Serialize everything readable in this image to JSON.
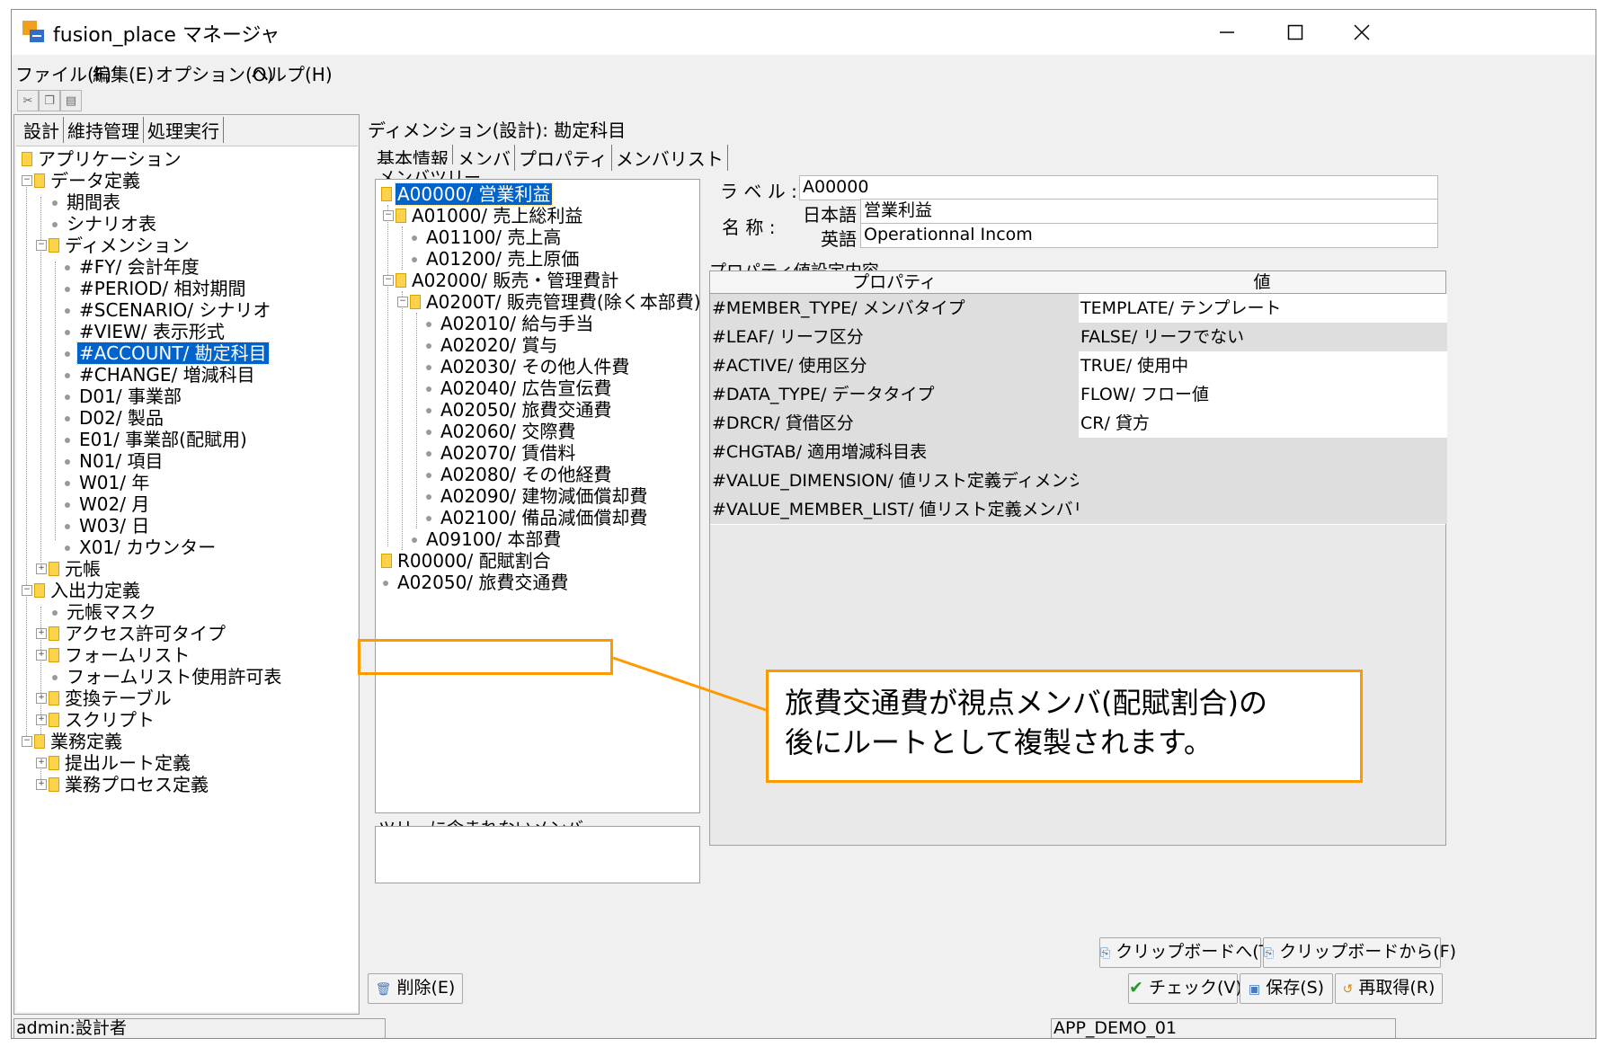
{
  "window": {
    "title": "fusion_place マネージャ",
    "minimize": "—",
    "maximize": "☐",
    "close": "✕"
  },
  "menu": [
    "ファイル(F)",
    "編集(E)",
    "オプション(O)",
    "ヘルプ(H)"
  ],
  "toolbar": {
    "icons": [
      "cut-icon",
      "copy-icon",
      "paste-icon"
    ]
  },
  "left_tabs": [
    "設計",
    "維持管理",
    "処理実行"
  ],
  "nav_tree": [
    "アプリケーション",
    "データ定義",
    "期間表",
    "シナリオ表",
    "ディメンション",
    "#FY/ 会計年度",
    "#PERIOD/ 相対期間",
    "#SCENARIO/ シナリオ",
    "#VIEW/ 表示形式",
    "#ACCOUNT/ 勘定科目",
    "#CHANGE/ 増減科目",
    "D01/ 事業部",
    "D02/ 製品",
    "E01/ 事業部(配賦用)",
    "N01/ 項目",
    "W01/ 年",
    "W02/ 月",
    "W03/ 日",
    "X01/ カウンター",
    "元帳",
    "入出力定義",
    "元帳マスク",
    "アクセス許可タイプ",
    "フォームリスト",
    "フォームリスト使用許可表",
    "変換テーブル",
    "スクリプト",
    "業務定義",
    "提出ルート定義",
    "業務プロセス定義"
  ],
  "dimension_title": "ディメンション(設計): 勘定科目",
  "inner_tabs": [
    "基本情報",
    "メンバ",
    "プロパティ",
    "メンバリスト"
  ],
  "member_tree_title": "メンバツリー",
  "member_tree": [
    "A00000/ 営業利益",
    "A01000/ 売上総利益",
    "A01100/ 売上高",
    "A01200/ 売上原価",
    "A02000/ 販売・管理費計",
    "A0200T/ 販売管理費(除く本部費)",
    "A02010/ 給与手当",
    "A02020/ 賞与",
    "A02030/ その他人件費",
    "A02040/ 広告宣伝費",
    "A02050/ 旅費交通費",
    "A02060/ 交際費",
    "A02070/ 賃借料",
    "A02080/ その他経費",
    "A02090/ 建物減価償却費",
    "A02100/ 備品減価償却費",
    "A09100/ 本部費",
    "R00000/ 配賦割合",
    "A02050/ 旅費交通費"
  ],
  "not_in_tree_title": "ツリーに含まれないメンバ",
  "label_field": {
    "caption": "ラ ベ ル :",
    "value": "A00000"
  },
  "name_field": {
    "caption": "名 称 :",
    "ja_caption": "日本語",
    "ja_value": "営業利益",
    "en_caption": "英語",
    "en_value": "Operationnal Incom"
  },
  "property_section_title": "プロパティ値設定内容",
  "property_grid": {
    "headers": [
      "プロパティ",
      "値"
    ],
    "rows": [
      [
        "#MEMBER_TYPE/ メンバタイプ",
        "TEMPLATE/ テンプレート"
      ],
      [
        "#LEAF/ リーフ区分",
        "FALSE/ リーフでない"
      ],
      [
        "#ACTIVE/ 使用区分",
        "TRUE/ 使用中"
      ],
      [
        "#DATA_TYPE/ データタイプ",
        "FLOW/ フロー値"
      ],
      [
        "#DRCR/ 貸借区分",
        "CR/ 貸方"
      ],
      [
        "#CHGTAB/ 適用増減科目表",
        ""
      ],
      [
        "#VALUE_DIMENSION/ 値リスト定義ディメンション",
        ""
      ],
      [
        "#VALUE_MEMBER_LIST/ 値リスト定義メンバリスト",
        ""
      ]
    ]
  },
  "buttons": {
    "to_clipboard": "クリップボードへ(T)",
    "from_clipboard": "クリップボードから(F)",
    "delete": "削除(E)",
    "check": "チェック(V)",
    "save": "保存(S)",
    "reload": "再取得(R)"
  },
  "status": {
    "user": "admin:設計者",
    "app": "APP_DEMO_01"
  },
  "callout": {
    "line1": "旅費交通費が視点メンバ(配賦割合)の",
    "line2": "後にルートとして複製されます。"
  },
  "colors": {
    "selection": "#0063cc",
    "highlight": "#ff9900",
    "folder": "#ffd24d"
  }
}
